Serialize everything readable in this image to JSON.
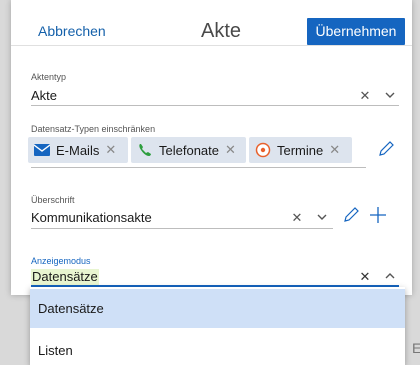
{
  "header": {
    "cancel_label": "Abbrechen",
    "title": "Akte",
    "apply_label": "Übernehmen"
  },
  "fields": {
    "aktentyp": {
      "label": "Aktentyp",
      "value": "Akte"
    },
    "datensatz": {
      "label": "Datensatz-Typen einschränken",
      "chips": [
        {
          "label": "E-Mails",
          "icon": "mail-icon"
        },
        {
          "label": "Telefonate",
          "icon": "phone-icon"
        },
        {
          "label": "Termine",
          "icon": "appointment-icon"
        }
      ]
    },
    "ueberschrift": {
      "label": "Überschrift",
      "value": "Kommunikationsakte"
    },
    "anzeigemodus": {
      "label": "Anzeigemodus",
      "value": "Datensätze"
    }
  },
  "dropdown": {
    "options": [
      "Datensätze",
      "Listen"
    ],
    "selected": "Datensätze"
  },
  "background_stub": "E",
  "colors": {
    "accent": "#1565c0",
    "link": "#1460aa",
    "chip_bg": "#dde4ee",
    "selected_bg": "#cfe0f7",
    "highlight_value_bg": "#e8f5d0"
  }
}
